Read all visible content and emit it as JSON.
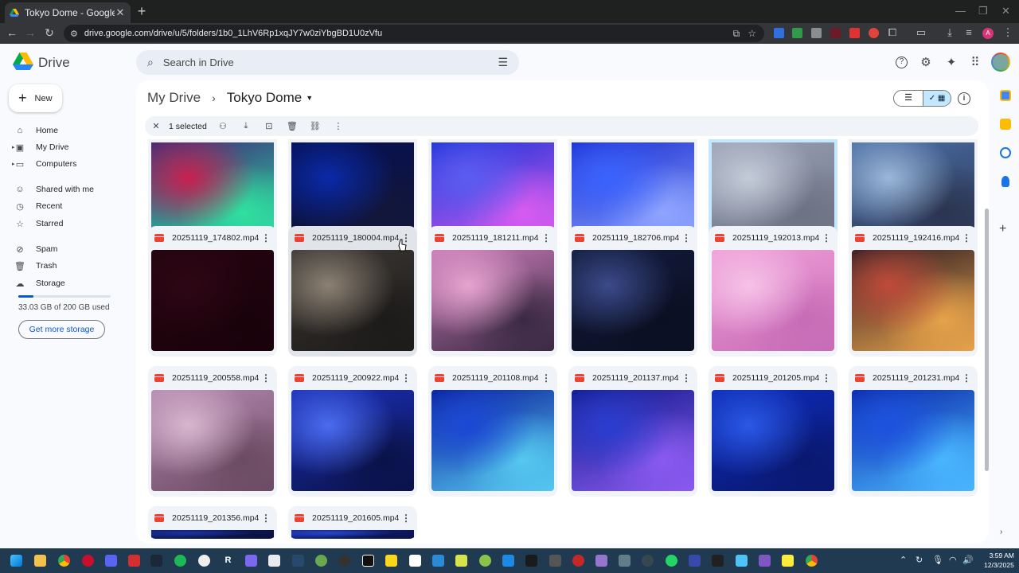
{
  "browser": {
    "tab_title": "Tokyo Dome - Google Drive",
    "url": "drive.google.com/drive/u/5/folders/1b0_1LhV6Rp1xqJY7w0ziYbgBD1U0zVfu",
    "profile_initial": "A"
  },
  "app": {
    "name": "Drive",
    "search_placeholder": "Search in Drive",
    "new_label": "New"
  },
  "sidebar": {
    "items": [
      {
        "label": "Home",
        "icon": "home-icon"
      },
      {
        "label": "My Drive",
        "icon": "my-drive-icon"
      },
      {
        "label": "Computers",
        "icon": "computer-icon"
      },
      {
        "label": "Shared with me",
        "icon": "people-icon"
      },
      {
        "label": "Recent",
        "icon": "clock-icon"
      },
      {
        "label": "Starred",
        "icon": "star-icon"
      },
      {
        "label": "Spam",
        "icon": "spam-icon"
      },
      {
        "label": "Trash",
        "icon": "trash-icon"
      },
      {
        "label": "Storage",
        "icon": "cloud-icon"
      }
    ],
    "storage_used_fraction": 0.165,
    "storage_text": "33.03 GB of 200 GB used",
    "get_more_label": "Get more storage"
  },
  "breadcrumb": {
    "root": "My Drive",
    "current": "Tokyo Dome"
  },
  "selection": {
    "count_label": "1 selected"
  },
  "files": [
    {
      "name": "",
      "thumb": [
        "#3b2a7a",
        "#c8204f",
        "#2fe0a0"
      ]
    },
    {
      "name": "",
      "thumb": [
        "#061052",
        "#0a2aa8",
        "#12163a"
      ]
    },
    {
      "name": "",
      "thumb": [
        "#1a33d6",
        "#5b5df2",
        "#d75bf0"
      ]
    },
    {
      "name": "",
      "thumb": [
        "#1a2fd0",
        "#3a63ff",
        "#8fa4ff"
      ]
    },
    {
      "name": "",
      "thumb": [
        "#9aa2b6",
        "#c4cbd8",
        "#6d7284"
      ]
    },
    {
      "name": "",
      "thumb": [
        "#4a6fa8",
        "#9bb7d8",
        "#2b3550"
      ]
    },
    {
      "name": "20251119_174802.mp4",
      "thumb": [
        "#240410",
        "#2d0614",
        "#1a020b"
      ]
    },
    {
      "name": "20251119_180004.mp4",
      "thumb": [
        "#3a3633",
        "#8c8173",
        "#1d1b1a"
      ]
    },
    {
      "name": "20251119_181211.mp4",
      "thumb": [
        "#c97bb8",
        "#e6a3d0",
        "#3b2a44"
      ]
    },
    {
      "name": "20251119_182706.mp4",
      "thumb": [
        "#121a3a",
        "#3b4a8a",
        "#0b0f22"
      ]
    },
    {
      "name": "20251119_192013.mp4",
      "thumb": [
        "#f0a0d8",
        "#f6c2e8",
        "#c76bb6"
      ]
    },
    {
      "name": "20251119_192416.mp4",
      "thumb": [
        "#2a1a24",
        "#c04a3a",
        "#e6a24a"
      ]
    },
    {
      "name": "20251119_200558.mp4",
      "thumb": [
        "#b58ab0",
        "#d8b6cf",
        "#6b4a63"
      ]
    },
    {
      "name": "20251119_200922.mp4",
      "thumb": [
        "#1c2fb8",
        "#4a6cf0",
        "#0a1248"
      ]
    },
    {
      "name": "20251119_201108.mp4",
      "thumb": [
        "#0a1e9a",
        "#1b48d6",
        "#55c8f0"
      ]
    },
    {
      "name": "20251119_201137.mp4",
      "thumb": [
        "#0f1a8a",
        "#2a3ed0",
        "#8a5af0"
      ]
    },
    {
      "name": "20251119_201205.mp4",
      "thumb": [
        "#0d2bb8",
        "#2a58e6",
        "#0a1870"
      ]
    },
    {
      "name": "20251119_201231.mp4",
      "thumb": [
        "#0b28a8",
        "#1d52e0",
        "#49b6ff"
      ]
    },
    {
      "name": "20251119_201356.mp4",
      "thumb": [
        "#102070",
        "#1c32a0",
        "#0a1240"
      ]
    },
    {
      "name": "20251119_201605.mp4",
      "thumb": [
        "#162a9a",
        "#2a46c8",
        "#0b1450"
      ]
    }
  ],
  "taskbar": {
    "time": "3:59 AM",
    "date": "12/3/2025"
  }
}
